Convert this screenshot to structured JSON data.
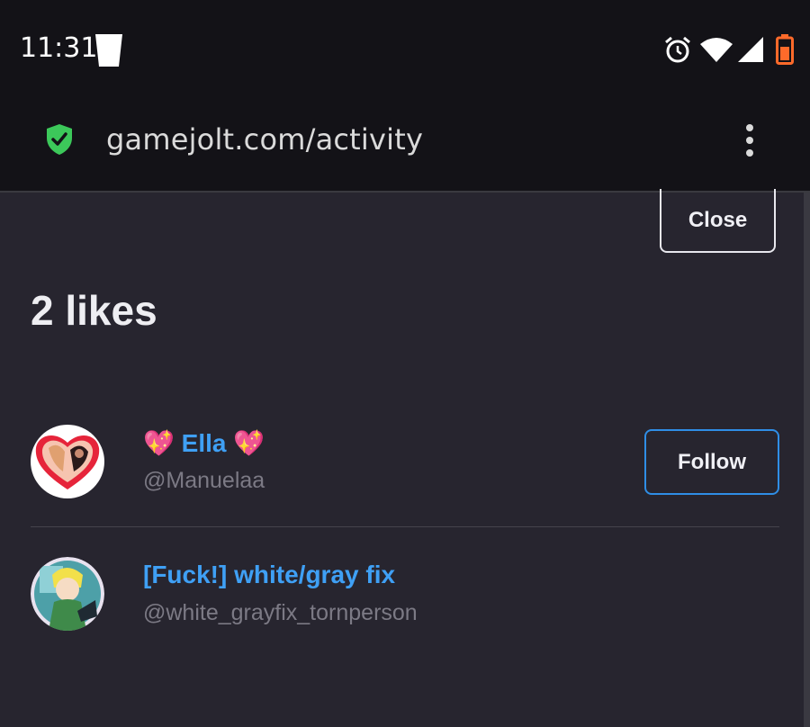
{
  "status_bar": {
    "time": "11:31",
    "icons": [
      "cup-icon",
      "alarm-icon",
      "wifi-icon",
      "signal-icon",
      "battery-icon"
    ],
    "battery_color": "#ff6a2a"
  },
  "browser": {
    "url": "gamejolt.com/activity",
    "secure_icon": "shield-check-icon",
    "secure_color": "#3cc85a",
    "menu_icon": "kebab-menu-icon"
  },
  "modal": {
    "close_label": "Close",
    "title": "2 likes",
    "users": [
      {
        "name": "💖 Ella 💖",
        "handle": "@Manuelaa",
        "follow_label": "Follow",
        "avatar_icon": "heart-avatar-icon"
      },
      {
        "name": "[Fuck!] white/gray fix",
        "handle": "@white_grayfix_tornperson",
        "avatar_icon": "character-avatar-icon"
      }
    ]
  },
  "colors": {
    "background": "#27252f",
    "username": "#3fa0f5",
    "follow_border": "#2f8ee6"
  }
}
